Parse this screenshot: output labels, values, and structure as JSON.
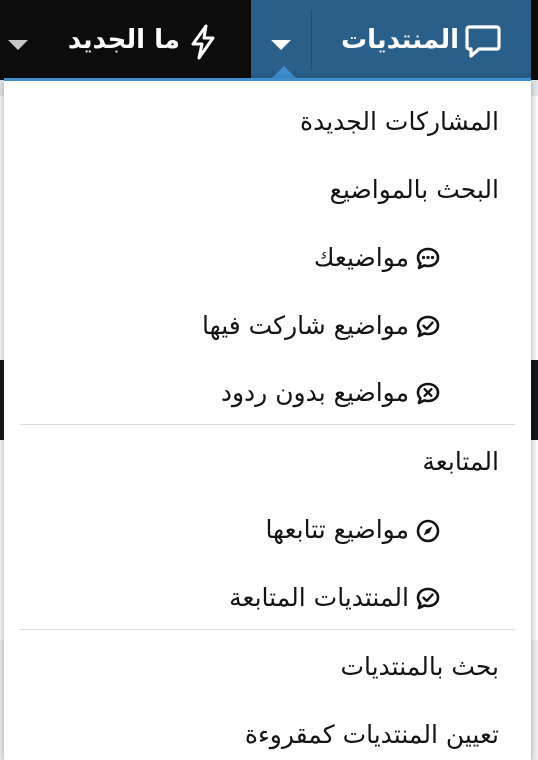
{
  "nav": {
    "forums_label": "المنتديات",
    "whats_new_label": "ما الجديد"
  },
  "colors": {
    "topbar_bg": "#0c0c0c",
    "active_tab_bg": "#2a5f8a",
    "menu_accent": "#3f8fd0",
    "menu_text": "#141414"
  },
  "menu": {
    "items": [
      {
        "label": "المشاركات الجديدة",
        "icon": null
      },
      {
        "label": "البحث بالمواضيع",
        "icon": null
      },
      {
        "label": "مواضيعك",
        "icon": "comment-dots-icon"
      },
      {
        "label": "مواضيع شاركت فيها",
        "icon": "comment-check-icon"
      },
      {
        "label": "مواضيع بدون ردود",
        "icon": "comment-times-icon"
      },
      {
        "label": "المتابعة",
        "icon": null
      },
      {
        "label": "مواضيع تتابعها",
        "icon": "compass-icon"
      },
      {
        "label": "المنتديات المتابعة",
        "icon": "comment-check-icon"
      },
      {
        "label": "بحث بالمنتديات",
        "icon": null
      },
      {
        "label": "تعيين المنتديات كمقروءة",
        "icon": null
      }
    ]
  }
}
